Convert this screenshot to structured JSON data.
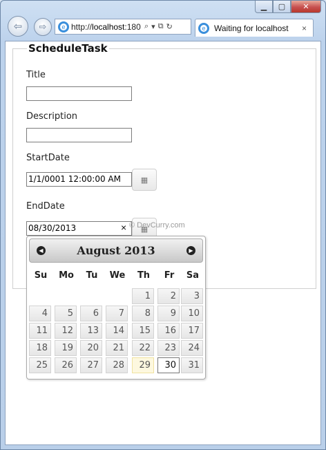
{
  "browser": {
    "url_prefix": "http://",
    "url_host": "localhost",
    "url_rest": ":180",
    "tab_title": "Waiting for localhost",
    "tab_close": "×",
    "caption": {
      "minimize": "▁",
      "maximize": "▢",
      "close": "✕"
    },
    "search_glyph": "⌕",
    "dropdown_glyph": "▾",
    "compat_glyph": "⧉",
    "refresh_glyph": "↻",
    "back_glyph": "⇦",
    "forward_glyph": "⇨",
    "ie_glyph": "e"
  },
  "form": {
    "legend": "ScheduleTask",
    "title_label": "Title",
    "title_value": "",
    "description_label": "Description",
    "description_value": "",
    "start_label": "StartDate",
    "start_value": "1/1/0001 12:00:00 AM",
    "end_label": "EndDate",
    "end_value": "08/30/2013",
    "clear_glyph": "×",
    "calendar_glyph": "▦",
    "watermark": "© DevCurry.com"
  },
  "datepicker": {
    "title": "August 2013",
    "prev_glyph": "◀",
    "next_glyph": "▶",
    "weekdays": [
      "Su",
      "Mo",
      "Tu",
      "We",
      "Th",
      "Fr",
      "Sa"
    ],
    "weeks": [
      [
        "",
        "",
        "",
        "",
        "1",
        "2",
        "3"
      ],
      [
        "4",
        "5",
        "6",
        "7",
        "8",
        "9",
        "10"
      ],
      [
        "11",
        "12",
        "13",
        "14",
        "15",
        "16",
        "17"
      ],
      [
        "18",
        "19",
        "20",
        "21",
        "22",
        "23",
        "24"
      ],
      [
        "25",
        "26",
        "27",
        "28",
        "29",
        "30",
        "31"
      ]
    ],
    "today": "29",
    "selected": "30"
  }
}
